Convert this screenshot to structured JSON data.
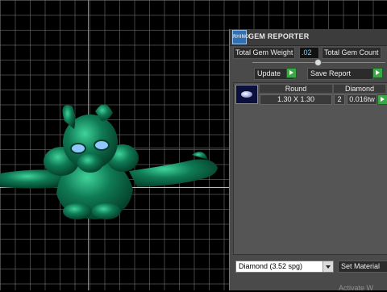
{
  "panel": {
    "title": "GEM REPORTER",
    "logo_text": "RHINO",
    "total_weight_label": "Total Gem Weight",
    "total_weight_value": ".02",
    "total_count_label": "Total Gem Count",
    "update_label": "Update",
    "save_report_label": "Save Report"
  },
  "gem_table": {
    "headers": [
      "Round",
      "Diamond"
    ],
    "rows": [
      {
        "size": "1.30 X 1.30",
        "count": "2",
        "weight": "0.016tw"
      }
    ]
  },
  "material": {
    "selected": "Diamond    (3.52 spg)",
    "set_material_label": "Set Material"
  },
  "watermark": "Activate W",
  "colors": {
    "model": "#0d6b4a",
    "axis_y": "#2fb7c4",
    "axis_x": "#c21a1a",
    "accent_green": "#3aa845"
  }
}
